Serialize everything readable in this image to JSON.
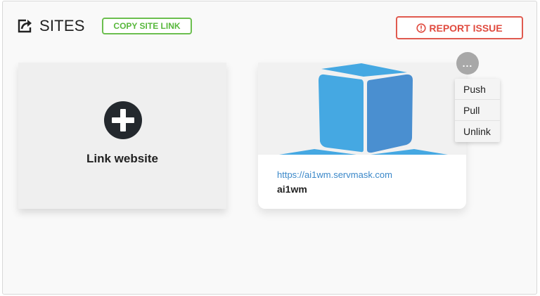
{
  "header": {
    "title": "SITES",
    "icon": "share-icon",
    "copy_link_label": "COPY SITE LINK",
    "report_label": "REPORT ISSUE",
    "report_icon": "alert-circle-icon"
  },
  "colors": {
    "copy_link": "#58b83c",
    "report": "#e04b3f",
    "link_url": "#3b88c9",
    "cube_light": "#45a8e2",
    "cube_dark": "#4a8fd0"
  },
  "link_card": {
    "label": "Link website",
    "icon": "plus-circle-icon"
  },
  "site": {
    "url": "https://ai1wm.servmask.com",
    "name": "ai1wm",
    "thumbnail_icon": "cube-icon"
  },
  "site_menu": {
    "trigger_label": "...",
    "items": [
      {
        "label": "Push"
      },
      {
        "label": "Pull"
      },
      {
        "label": "Unlink"
      }
    ]
  }
}
